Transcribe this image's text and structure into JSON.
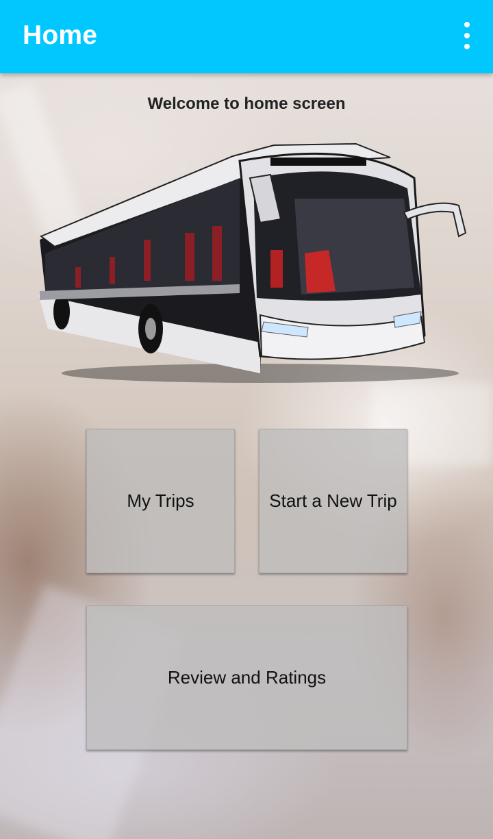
{
  "appbar": {
    "title": "Home",
    "overflow_icon": "more-vert-icon",
    "color": "#00c8ff"
  },
  "main": {
    "welcome_text": "Welcome to home screen",
    "hero_image": "bus-illustration"
  },
  "buttons": {
    "my_trips": "My Trips",
    "start_new_trip": "Start a New Trip",
    "review_ratings": "Review and Ratings"
  }
}
